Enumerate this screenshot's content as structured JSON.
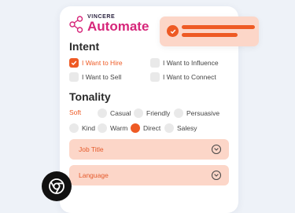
{
  "brand": {
    "small": "VINCERE",
    "name": "Automate",
    "color": "#d6267a"
  },
  "accent": "#ee5a24",
  "notification": {
    "icon": "check-icon"
  },
  "intent": {
    "heading": "Intent",
    "options": [
      {
        "label": "I Want to Hire",
        "checked": true
      },
      {
        "label": "I Want to Influence",
        "checked": false
      },
      {
        "label": "I Want to Sell",
        "checked": false
      },
      {
        "label": "I Want to Connect",
        "checked": false
      }
    ]
  },
  "tonality": {
    "heading": "Tonality",
    "options": [
      {
        "label": "Soft",
        "selected": true
      },
      {
        "label": "Casual",
        "selected": false
      },
      {
        "label": "Friendly",
        "selected": false
      },
      {
        "label": "Persuasive",
        "selected": false
      },
      {
        "label": "Kind",
        "selected": false
      },
      {
        "label": "Warm",
        "selected": false
      },
      {
        "label": "Direct",
        "selected": true
      },
      {
        "label": "Salesy",
        "selected": false
      }
    ]
  },
  "dropdowns": [
    {
      "label": "Job Title"
    },
    {
      "label": "Language"
    }
  ],
  "browser_icon": "chrome-icon"
}
